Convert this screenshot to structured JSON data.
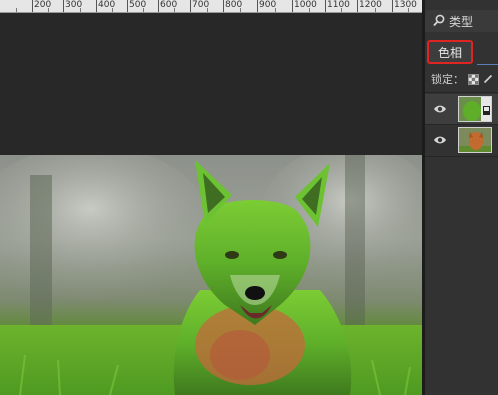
{
  "ruler": {
    "labels": [
      "200",
      "300",
      "400",
      "500",
      "600",
      "700",
      "800",
      "900",
      "1000",
      "1100",
      "1200",
      "1300"
    ]
  },
  "layers_panel": {
    "filter_label": "类型",
    "blend_mode": "色相",
    "lock_label": "锁定："
  },
  "colors": {
    "highlight": "#e02424",
    "fur_green": "#5fb02a"
  }
}
